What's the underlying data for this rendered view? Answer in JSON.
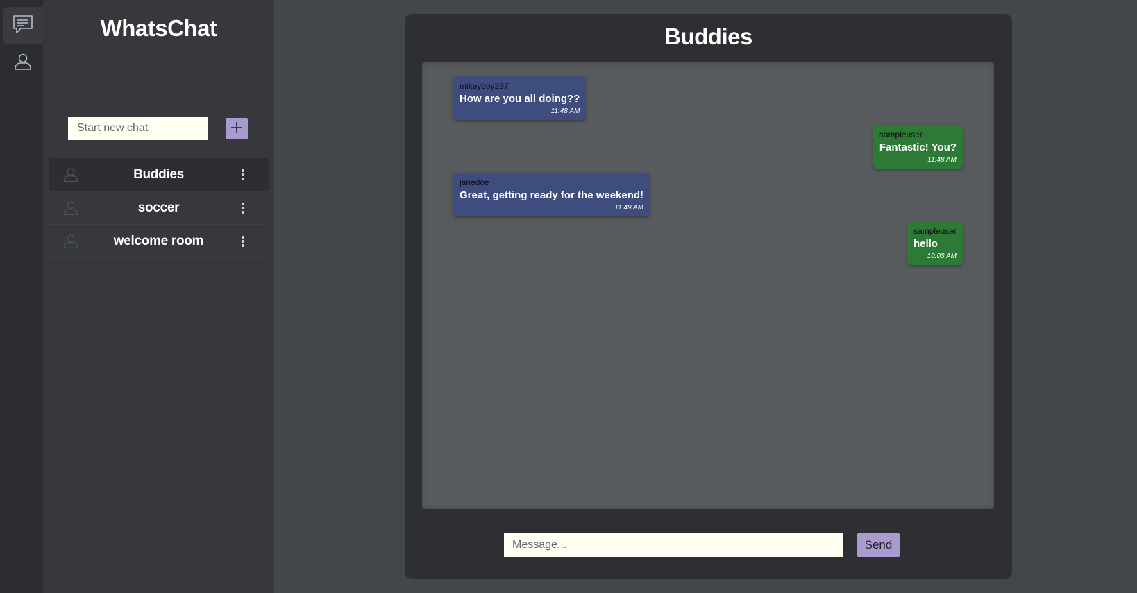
{
  "app": {
    "title": "WhatsChat"
  },
  "rail": {
    "items": [
      {
        "icon": "chat-icon",
        "active": true
      },
      {
        "icon": "profile-icon",
        "active": false
      }
    ]
  },
  "sidebar": {
    "new_chat_placeholder": "Start new chat",
    "add_icon": "plus-icon",
    "chats": [
      {
        "name": "Buddies",
        "active": true
      },
      {
        "name": "soccer",
        "active": false
      },
      {
        "name": "welcome room",
        "active": false
      }
    ]
  },
  "room": {
    "title": "Buddies",
    "messages": [
      {
        "sender": "mikeyboy237",
        "text": "How are you all doing??",
        "time": "11:48 AM",
        "mine": false
      },
      {
        "sender": "sampleuser",
        "text": "Fantastic! You?",
        "time": "11:48 AM",
        "mine": true
      },
      {
        "sender": "janedoe",
        "text": "Great, getting ready for the weekend!",
        "time": "11:49 AM",
        "mine": false
      },
      {
        "sender": "sampleuser",
        "text": "hello",
        "time": "10:03 AM",
        "mine": true
      }
    ]
  },
  "composer": {
    "placeholder": "Message...",
    "send_label": "Send"
  },
  "colors": {
    "background": "#44474a",
    "rail": "#2b2d30",
    "sidebar": "#36383b",
    "panel": "#2d2f32",
    "messages_area": "#585b5d",
    "accent": "#a99ad0",
    "incoming_bubble": "#3e4c7e",
    "outgoing_bubble": "#2d7a37",
    "input_bg": "#fffff2"
  }
}
